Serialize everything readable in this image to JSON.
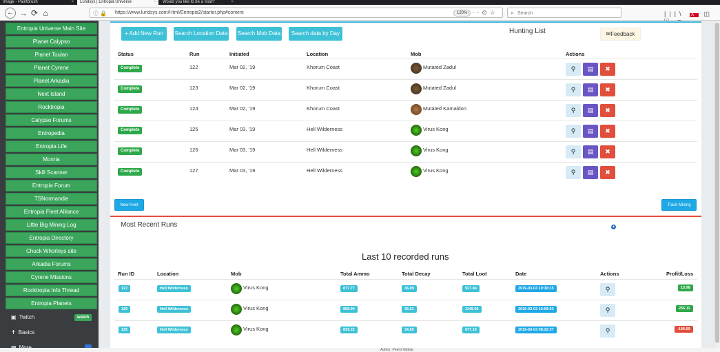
{
  "browser": {
    "tabs": [
      {
        "label": "Image - Paintbrush"
      },
      {
        "label": "Lundsys | Entropia Universe"
      },
      {
        "label": "Would you like to be a mod?"
      }
    ],
    "url": "https://www.lundsys.com/Html/Entropia2/starter.php#content",
    "zoom": "120%",
    "search_placeholder": "Search"
  },
  "sidebar": {
    "items": [
      "Entropia Universe Main Site",
      "Planet Calypso",
      "Planet Toulan",
      "Planet Cyrene",
      "Planet Arkadia",
      "Next Island",
      "Rocktropia",
      "Calypso Forums",
      "Entropedia",
      "Entropia Life",
      "Monria",
      "Skill Scanner",
      "Entropia Forum",
      "TSNormandie",
      "Entropia Fleet Alliance",
      "Little Big Mining Log",
      "Entropia Directory",
      "Chuck Whorleys site",
      "Arkadia Forums",
      "Cyrene Missions",
      "Rocktropia Info Thread",
      "Entropia Planets"
    ],
    "twitch": {
      "label": "Twitch",
      "badge": "watch"
    },
    "basics": {
      "label": "Basics"
    },
    "more": {
      "label": "More"
    }
  },
  "toolbar": {
    "add_new_run": "+ Add New Run",
    "search_location": "Search Location Data",
    "search_mob": "Search Mob Data",
    "search_day": "Search data by Day",
    "hunting_list": "Hunting List",
    "feedback": "Feedback"
  },
  "hunting": {
    "headers": {
      "status": "Status",
      "run": "Run",
      "initiated": "Initiated",
      "location": "Location",
      "mob": "Mob",
      "actions": "Actions"
    },
    "rows": [
      {
        "status": "Complete",
        "run": "122",
        "initiated": "Mar 02, '19",
        "location": "Khorum Coast",
        "mob": "Mutated Zadul"
      },
      {
        "status": "Complete",
        "run": "123",
        "initiated": "Mar 02, '19",
        "location": "Khorum Coast",
        "mob": "Mutated Zadul"
      },
      {
        "status": "Complete",
        "run": "124",
        "initiated": "Mar 02, '19",
        "location": "Khorum Coast",
        "mob": "Mutated Kamaldon"
      },
      {
        "status": "Complete",
        "run": "125",
        "initiated": "Mar 03, '19",
        "location": "Hell Wilderness",
        "mob": "Virus Kong"
      },
      {
        "status": "Complete",
        "run": "126",
        "initiated": "Mar 03, '19",
        "location": "Hell Wilderness",
        "mob": "Virus Kong"
      },
      {
        "status": "Complete",
        "run": "127",
        "initiated": "Mar 03, '19",
        "location": "Hell Wilderness",
        "mob": "Virus Kong"
      }
    ],
    "new_hunt": "New Hunt",
    "track_mining": "Track Mining"
  },
  "recent": {
    "title": "Most Recent Runs",
    "subtitle": "Last 10 recorded runs",
    "headers": {
      "run_id": "Run ID",
      "location": "Location",
      "mob": "Mob",
      "total_ammo": "Total Ammo",
      "total_decay": "Total Decay",
      "total_loot": "Total Loot",
      "date": "Date",
      "actions": "Actions",
      "profit_loss": "Profit/Loss"
    },
    "rows": [
      {
        "run_id": "127",
        "location": "Hell Wilderness",
        "mob": "Virus Kong",
        "total_ammo": "877.77",
        "total_decay": "36.09",
        "total_loot": "927.84",
        "date": "2019-03-03 10:30:15",
        "profit": "13.98",
        "profit_sign": "pos"
      },
      {
        "run_id": "126",
        "location": "Hell Wilderness",
        "mob": "Virus Kong",
        "total_ammo": "858.94",
        "total_decay": "35.51",
        "total_loot": "1149.56",
        "date": "2019-03-03 10:59:53",
        "profit": "255.11",
        "profit_sign": "pos"
      },
      {
        "run_id": "125",
        "location": "Hell Wilderness",
        "mob": "Virus Kong",
        "total_ammo": "839.22",
        "total_decay": "34.65",
        "total_loot": "677.19",
        "date": "2019-03-03 08:32:37",
        "profit": "-196.69",
        "profit_sign": "neg"
      }
    ]
  },
  "colors": {
    "accent": "#3ec1d6",
    "sidebar_item": "#3ba55c",
    "sidebar_bg": "#3a3d40",
    "danger": "#e14f3c",
    "purple": "#6a55c4"
  },
  "footer": {
    "text": "Author: Peertil Gibbar"
  }
}
